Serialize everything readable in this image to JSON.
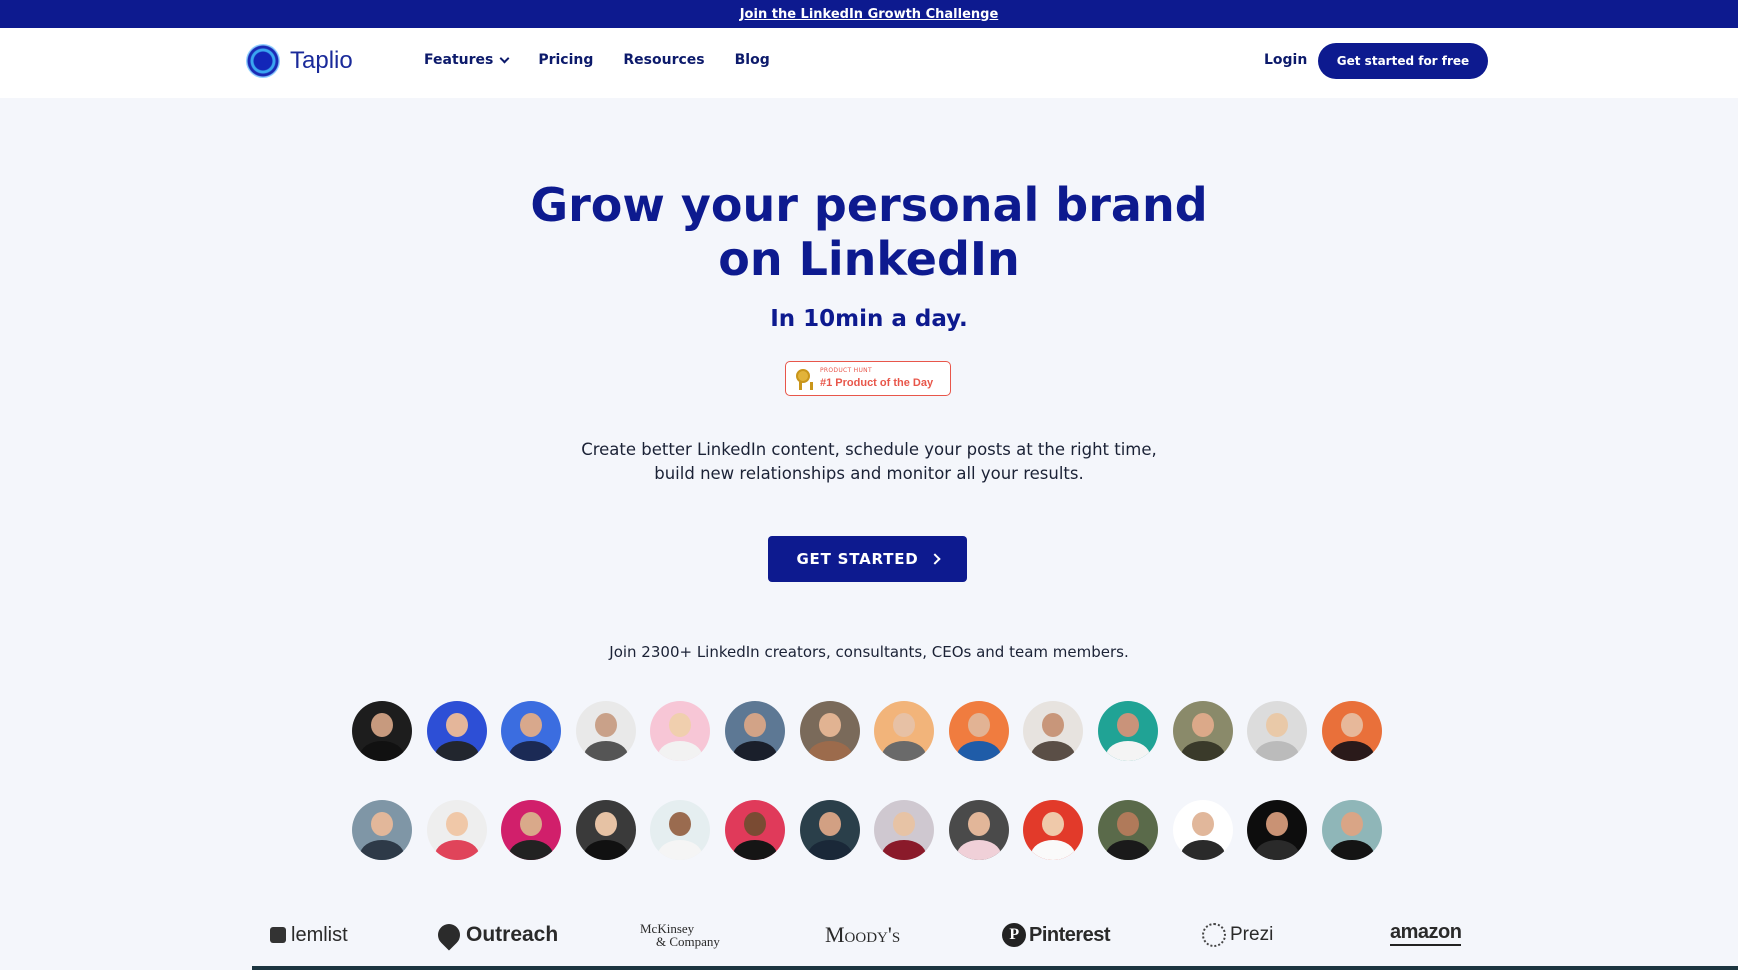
{
  "banner": {
    "text": "Join the LinkedIn Growth Challenge"
  },
  "nav": {
    "logo_text": "Taplio",
    "links": [
      "Features",
      "Pricing",
      "Resources",
      "Blog"
    ],
    "login": "Login",
    "cta": "Get started for free"
  },
  "hero": {
    "title_line1": "Grow your personal brand",
    "title_line2": "on LinkedIn",
    "subtitle": "In 10min a day.",
    "badge_small": "PRODUCT HUNT",
    "badge_main": "#1 Product of the Day",
    "desc_line1": "Create better LinkedIn content, schedule your posts at the right time,",
    "desc_line2": "build new relationships and monitor all your results.",
    "cta": "GET STARTED",
    "join_text": "Join 2300+ LinkedIn creators, consultants, CEOs and team members."
  },
  "logos": [
    "lemlist",
    "Outreach",
    "McKinsey",
    "& Company",
    "Moody's",
    "Pinterest",
    "Prezi",
    "amazon"
  ],
  "colors": {
    "brand": "#0d1a8f",
    "badge": "#e8564a",
    "bg": "#f4f6fb"
  }
}
